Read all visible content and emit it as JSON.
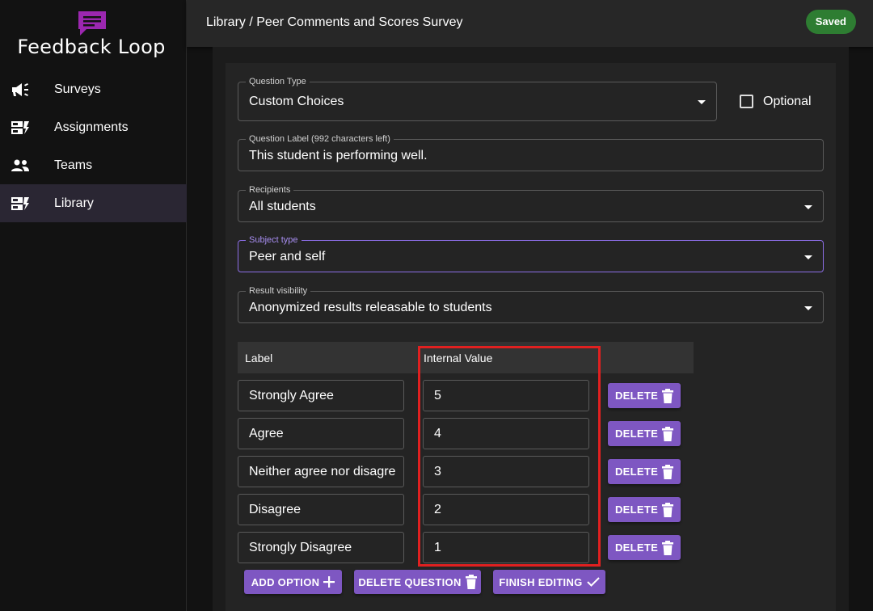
{
  "app": {
    "title": "Feedback Loop"
  },
  "sidebar": {
    "items": [
      {
        "label": "Surveys",
        "icon": "megaphone-icon"
      },
      {
        "label": "Assignments",
        "icon": "assignment-icon"
      },
      {
        "label": "Teams",
        "icon": "people-icon"
      },
      {
        "label": "Library",
        "icon": "library-icon"
      }
    ],
    "active": "Library"
  },
  "header": {
    "breadcrumb": "Library / Peer Comments and Scores Survey",
    "status_badge": "Saved"
  },
  "form": {
    "question_type": {
      "legend": "Question Type",
      "value": "Custom Choices"
    },
    "optional": {
      "label": "Optional",
      "checked": false
    },
    "question_label": {
      "legend": "Question Label (992 characters left)",
      "value": "This student is performing well."
    },
    "recipients": {
      "legend": "Recipients",
      "value": "All students"
    },
    "subject_type": {
      "legend": "Subject type",
      "value": "Peer and self"
    },
    "result_visibility": {
      "legend": "Result visibility",
      "value": "Anonymized results releasable to students"
    }
  },
  "options_table": {
    "headers": {
      "label": "Label",
      "internal_value": "Internal Value"
    },
    "rows": [
      {
        "label": "Strongly Agree",
        "value": "5",
        "delete_label": "DELETE"
      },
      {
        "label": "Agree",
        "value": "4",
        "delete_label": "DELETE"
      },
      {
        "label": "Neither agree nor disagre",
        "value": "3",
        "delete_label": "DELETE"
      },
      {
        "label": "Disagree",
        "value": "2",
        "delete_label": "DELETE"
      },
      {
        "label": "Strongly Disagree",
        "value": "1",
        "delete_label": "DELETE"
      }
    ]
  },
  "actions": {
    "add_option": "ADD OPTION",
    "delete_question": "DELETE QUESTION",
    "finish_editing": "FINISH EDITING"
  },
  "colors": {
    "accent": "#7e57c2",
    "saved": "#2e7d32",
    "highlight": "#e02020",
    "brand_icon": "#9c27b0"
  }
}
